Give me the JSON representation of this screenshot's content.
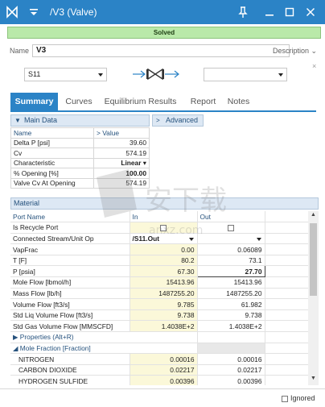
{
  "window": {
    "title": "/V3 (Valve)",
    "accent": "#2b83c6"
  },
  "status": {
    "text": "Solved",
    "color": "#b9e9a9"
  },
  "header": {
    "name_label": "Name",
    "name_value": "V3",
    "description_label": "Description ⌄",
    "close_glyph": "×",
    "inlet_stream": "S11",
    "outlet_stream": ""
  },
  "tabs": [
    "Summary",
    "Curves",
    "Equilibrium Results",
    "Report",
    "Notes"
  ],
  "main_data": {
    "section_title": "Main Data",
    "advanced_title": "Advanced",
    "col_name": "Name",
    "col_value": "Value",
    "rows": [
      {
        "name": "Delta P [psi]",
        "value": "39.60"
      },
      {
        "name": "Cv",
        "value": "574.19"
      },
      {
        "name": "Characteristic",
        "value": "Linear ▾"
      },
      {
        "name": "% Opening [%]",
        "value": "100.00"
      },
      {
        "name": "Valve Cv At Opening",
        "value": "574.19"
      }
    ]
  },
  "material": {
    "section_title": "Material",
    "headers": {
      "port_name": "Port Name",
      "in": "In",
      "out": "Out"
    },
    "recycle_label": "Is Recycle Port",
    "connected_label": "Connected Stream/Unit Op",
    "connected_in": "/S11.Out",
    "connected_out": "",
    "rows": [
      {
        "name": "VapFrac",
        "in": "0.00",
        "out": "0.06089"
      },
      {
        "name": "T [F]",
        "in": "80.2",
        "out": "73.1"
      },
      {
        "name": "P [psia]",
        "in": "67.30",
        "out": "27.70"
      },
      {
        "name": "Mole Flow [lbmol/h]",
        "in": "15413.96",
        "out": "15413.96"
      },
      {
        "name": "Mass Flow [lb/h]",
        "in": "1487255.20",
        "out": "1487255.20"
      },
      {
        "name": "Volume Flow [ft3/s]",
        "in": "9.785",
        "out": "61.982"
      },
      {
        "name": "Std Liq Volume Flow [ft3/s]",
        "in": "9.738",
        "out": "9.738"
      },
      {
        "name": "Std Gas Volume Flow [MMSCFD]",
        "in": "1.4038E+2",
        "out": "1.4038E+2"
      }
    ],
    "properties_label": "Properties  (Alt+R)",
    "mole_fraction_label": "Mole Fraction [Fraction]",
    "components": [
      {
        "name": "NITROGEN",
        "in": "0.00016",
        "out": "0.00016"
      },
      {
        "name": "CARBON DIOXIDE",
        "in": "0.02217",
        "out": "0.02217"
      },
      {
        "name": "HYDROGEN SULFIDE",
        "in": "0.00396",
        "out": "0.00396"
      }
    ]
  },
  "footer": {
    "ignored_label": "Ignored"
  },
  "watermark": {
    "text": "安下载",
    "subtext": "anxz.com"
  }
}
